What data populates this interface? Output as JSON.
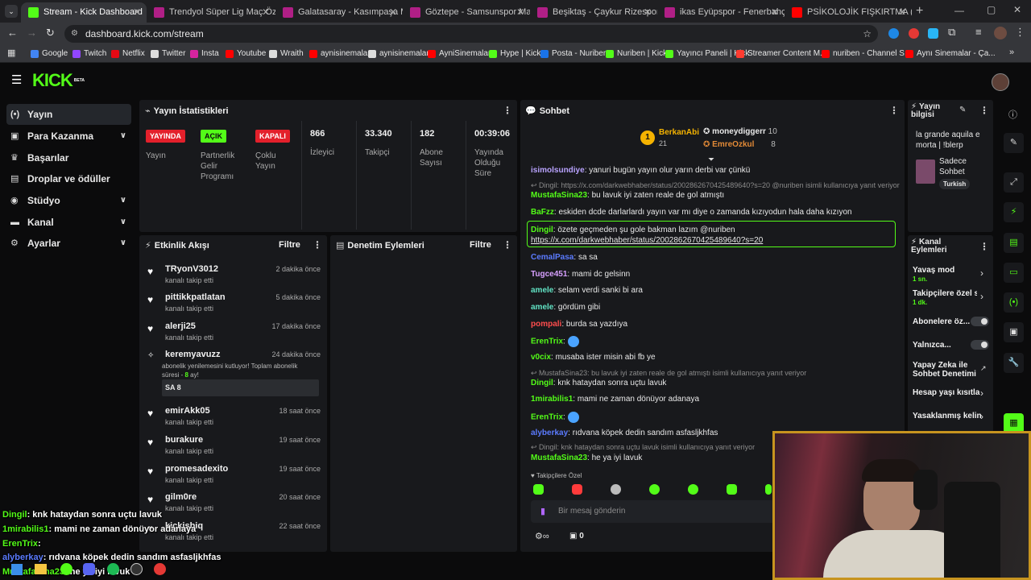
{
  "browser": {
    "tabs": [
      {
        "title": "Stream - Kick Dashboard",
        "color": "#53fc18"
      },
      {
        "title": "Trendyol Süper Lig Maç Özetleri",
        "color": "#b01f86"
      },
      {
        "title": "Galatasaray - Kasımpaşa Maç Özeti",
        "color": "#b01f86"
      },
      {
        "title": "Göztepe - Samsunspor Maç Özeti",
        "color": "#b01f86"
      },
      {
        "title": "Beşiktaş - Çaykur Rizespor Maç Özeti",
        "color": "#b01f86"
      },
      {
        "title": "ikas Eyüpspor - Fenerbahçe Maç Özeti",
        "color": "#b01f86"
      },
      {
        "title": "PSİKOLOJİK FIŞKIRTMA (ÖZET...",
        "color": "#ff0000"
      }
    ],
    "url": "dashboard.kick.com/stream",
    "bookmarks": [
      {
        "label": "Google",
        "color": "#4285f4"
      },
      {
        "label": "Twitch",
        "color": "#9146ff"
      },
      {
        "label": "Netflix",
        "color": "#e50914"
      },
      {
        "label": "Twitter",
        "color": "#dddddd"
      },
      {
        "label": "Insta",
        "color": "#d6249f"
      },
      {
        "label": "Youtube",
        "color": "#ff0000"
      },
      {
        "label": "Wraith",
        "color": "#dddddd"
      },
      {
        "label": "aynisinemalar",
        "color": "#ff0000"
      },
      {
        "label": "aynisinemalar",
        "color": "#dddddd"
      },
      {
        "label": "AyniSinemalar",
        "color": "#ff0000"
      },
      {
        "label": "Hype | Kick",
        "color": "#53fc18"
      },
      {
        "label": "Posta - Nuriben",
        "color": "#1a73e8"
      },
      {
        "label": "Nuriben | Kick",
        "color": "#53fc18"
      },
      {
        "label": "Yayıncı Paneli | Kick",
        "color": "#53fc18"
      },
      {
        "label": "Streamer Content M...",
        "color": "#ff3b30"
      },
      {
        "label": "nuriben - Channel S...",
        "color": "#ff0000"
      },
      {
        "label": "Aynı Sinemalar - Ça...",
        "color": "#ff0000"
      }
    ]
  },
  "kick": {
    "logo": "KICK",
    "logo_beta": "BETA",
    "sidebar": [
      {
        "label": "Yayın",
        "icon": "broadcast-icon"
      },
      {
        "label": "Para Kazanma",
        "icon": "money-icon"
      },
      {
        "label": "Başarılar",
        "icon": "trophy-icon"
      },
      {
        "label": "Droplar ve ödüller",
        "icon": "gift-icon"
      },
      {
        "label": "Stüdyo",
        "icon": "studio-icon"
      },
      {
        "label": "Kanal",
        "icon": "channel-icon"
      },
      {
        "label": "Ayarlar",
        "icon": "gear-icon"
      }
    ],
    "stats": {
      "title": "Yayın İstatistikleri",
      "live_badge": "YAYINDA",
      "live_label": "Yayın",
      "partner_badge": "AÇIK",
      "partner_label": "Partnerlik Gelir Programı",
      "multi_badge": "KAPALI",
      "multi_label": "Çoklu Yayın",
      "viewers": "866",
      "viewers_label": "İzleyici",
      "followers": "33.340",
      "followers_label": "Takipçi",
      "subs": "182",
      "subs_label": "Abone Sayısı",
      "uptime": "00:39:06",
      "uptime_label": "Yayında Olduğu Süre"
    },
    "activity": {
      "title": "Etkinlik Akışı",
      "filter": "Filtre",
      "items": [
        {
          "name": "TRyonV3012",
          "sub": "kanalı takip etti",
          "time": "2 dakika önce"
        },
        {
          "name": "pittikkpatlatan",
          "sub": "kanalı takip etti",
          "time": "5 dakika önce"
        },
        {
          "name": "alerji25",
          "sub": "kanalı takip etti",
          "time": "17 dakika önce"
        },
        {
          "name": "emirAkk05",
          "sub": "kanalı takip etti",
          "time": "18 saat önce"
        },
        {
          "name": "burakure",
          "sub": "kanalı takip etti",
          "time": "19 saat önce"
        },
        {
          "name": "promesadexito",
          "sub": "kanalı takip etti",
          "time": "19 saat önce"
        },
        {
          "name": "gilm0re",
          "sub": "kanalı takip etti",
          "time": "20 saat önce"
        },
        {
          "name": "kickisbiq",
          "sub": "kanalı takip etti",
          "time": "22 saat önce"
        }
      ],
      "sub_item": {
        "name": "keremyavuzz",
        "time": "24 dakika önce",
        "text1": "abonelik yenilemesini kutluyor! Toplam abonelik",
        "text2": "süresi -",
        "months": "8",
        "text3": "ay!",
        "message": "SA 8"
      }
    },
    "moderation": {
      "title": "Denetim Eylemleri",
      "filter": "Filtre"
    },
    "chat": {
      "title": "Sohbet",
      "top": {
        "first": "BerkanAbi",
        "first_count": "21",
        "second": "moneydiggerr",
        "second_count": "10",
        "third": "EmreOzkul",
        "third_count": "8"
      },
      "messages": [
        {
          "user": "isimolsundiye",
          "color": "#b9a3ff",
          "text": "yanuri bugün yayın olur yarın derbi var çünkü"
        },
        {
          "reply": "Dingil: https://x.com/darkwebhaber/status/2002862670425489640?s=20 @nuriben isimli kullanıcıya yanıt veriyor"
        },
        {
          "user": "MustafaSina23",
          "color": "#53fc18",
          "text": "bu lavuk iyi zaten reale de gol atmıştı"
        },
        {
          "user": "BaFzz",
          "color": "#53fc18",
          "text": "eskiden dcde darlarlardı yayın var mı diye o zamanda kızıyodun hala daha kızıyon"
        },
        {
          "user": "Dingil",
          "color": "#53fc18",
          "text": "özete geçmeden şu gole bakman lazım @nuriben",
          "link": "https://x.com/darkwebhaber/status/2002862670425489640?s=20"
        },
        {
          "user": "CemalPasa",
          "color": "#5b7bff",
          "text": "sa sa"
        },
        {
          "user": "Tugce451",
          "color": "#d7a0ff",
          "text": "mami dc gelsinn"
        },
        {
          "user": "amele",
          "color": "#61e3c4",
          "text": "selam verdi sanki bi ara"
        },
        {
          "user": "amele",
          "color": "#61e3c4",
          "text": "gördüm gibi"
        },
        {
          "user": "pompali",
          "color": "#ff4d4d",
          "text": "burda sa yazdıya"
        },
        {
          "user": "ErenTrix",
          "color": "#53fc18",
          "text": ""
        },
        {
          "user": "v0cix",
          "color": "#53fc18",
          "text": "musaba ister misin abi fb ye"
        },
        {
          "reply": "MustafaSina23: bu lavuk iyi zaten reale de gol atmıştı isimli kullanıcıya yanıt veriyor"
        },
        {
          "user": "Dingil",
          "color": "#53fc18",
          "text": "knk hataydan sonra uçtu lavuk"
        },
        {
          "user": "1mirabilis1",
          "color": "#53fc18",
          "text": "mami ne zaman dönüyor adanaya"
        },
        {
          "user": "ErenTrix",
          "color": "#53fc18",
          "text": ""
        },
        {
          "user": "alyberkay",
          "color": "#5b7bff",
          "text": "rıdvana köpek dedin sandım asfasljkhfas"
        },
        {
          "reply": "Dingil: knk hataydan sonra uçtu lavuk isimli kullanıcıya yanıt veriyor"
        },
        {
          "user": "MustafaSina23",
          "color": "#53fc18",
          "text": "he ya iyi lavuk"
        }
      ],
      "followers_only": "Takipçilere Özel",
      "input_placeholder": "Bir mesaj gönderin",
      "points": "0"
    },
    "stream_info": {
      "title": "Yayın bilgisi",
      "stream_title": "la grande aquila e morta | !blerp",
      "category": "Sadece Sohbet",
      "tag": "Turkish"
    },
    "channel_actions": {
      "title": "Kanal Eylemleri",
      "slow_mode": "Yavaş mod",
      "slow_value": "1 sn.",
      "followers_mode": "Takipçilere özel s",
      "followers_value": "1 dk.",
      "subs_only": "Abonelere öz...",
      "alone": "Yalnızca...",
      "ai_mod": "Yapay Zeka ile Sohbet Denetimi",
      "age": "Hesap yaşı kısıtla",
      "banned": "Yasaklanmış kelin"
    }
  },
  "overlay": [
    {
      "user": "Dingil",
      "color": "#53fc18",
      "text": ": knk hataydan sonra uçtu lavuk"
    },
    {
      "user": "1mirabilis1",
      "color": "#53fc18",
      "text": ": mami ne zaman dönüyor adanaya"
    },
    {
      "user": "ErenTrix",
      "color": "#53fc18",
      "text": ":"
    },
    {
      "user": "alyberkay",
      "color": "#5b7bff",
      "text": ": rıdvana köpek dedin sandım asfasljkhfas"
    },
    {
      "user": "MustafaSina23",
      "color": "#53fc18",
      "text": ": he ya iyi lavuk"
    }
  ]
}
